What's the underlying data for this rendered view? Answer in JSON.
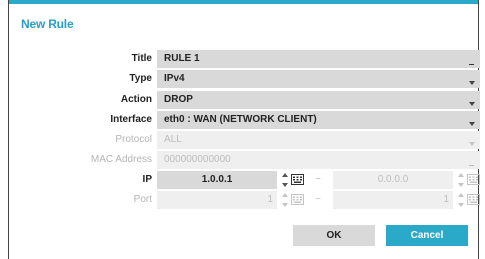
{
  "dialog": {
    "title": "New Rule"
  },
  "fields": {
    "title": {
      "label": "Title",
      "value": "RULE 1"
    },
    "type": {
      "label": "Type",
      "value": "IPv4"
    },
    "action": {
      "label": "Action",
      "value": "DROP"
    },
    "interface": {
      "label": "Interface",
      "value": "eth0 : WAN (NETWORK CLIENT)"
    },
    "protocol": {
      "label": "Protocol",
      "value": "ALL"
    },
    "mac": {
      "label": "MAC Address",
      "value": "000000000000"
    },
    "ip": {
      "label": "IP",
      "from": "1.0.0.1",
      "separator": "~",
      "to": "0.0.0.0"
    },
    "port": {
      "label": "Port",
      "from": "1",
      "separator": "~",
      "to": "1"
    }
  },
  "buttons": {
    "ok": "OK",
    "cancel": "Cancel"
  },
  "icons": {
    "dropdown": "chevron-down-icon",
    "spinner": "spinner-arrows-icon",
    "keyboard": "keyboard-icon"
  },
  "colors": {
    "accent": "#2aa9c9",
    "field": "#d9d9d9",
    "field_disabled": "#efefef"
  }
}
